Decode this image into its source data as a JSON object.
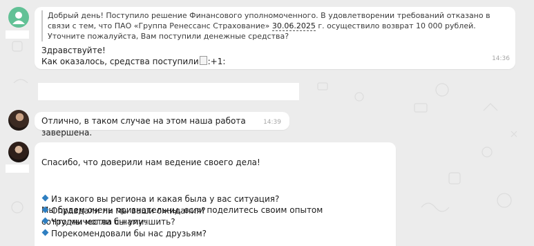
{
  "chat": {
    "message1": {
      "quote": {
        "text_before": "Добрый день! Поступило решение Финансового уполномоченного. В удовлетворении требований отказано в связи с тем, что ПАО «Группа Ренессанс Страхование» ",
        "date": "30.06.2025",
        "text_after": " г. осуществило возврат 10 000 рублей. Уточните пожалуйста, Вам поступили денежные средства?"
      },
      "line1": "Здравствуйте!",
      "line2": "Как оказалось, средства поступили",
      "line2_suffix": ":+1:",
      "time": "14:36"
    },
    "message2": {
      "text": "Отлично, в таком случае на этом наша работа завершена.",
      "time": "14:39"
    },
    "message3": {
      "intro": "Спасибо, что доверили нам ведение своего дела!",
      "lead": "Мы будем очень признательны, если поделитесь своим опытом сотрудничества с нами:",
      "questions": [
        "Из какого вы региона и какая была у вас ситуация?",
        "Оправдали ли мы ваши ожидания?",
        "Что мы могли бы улучшить?",
        "Порекомендовали бы нас друзьям?"
      ]
    },
    "colors": {
      "accent_diamond": "#2f7fc1",
      "generic_avatar": "#62c196"
    }
  }
}
